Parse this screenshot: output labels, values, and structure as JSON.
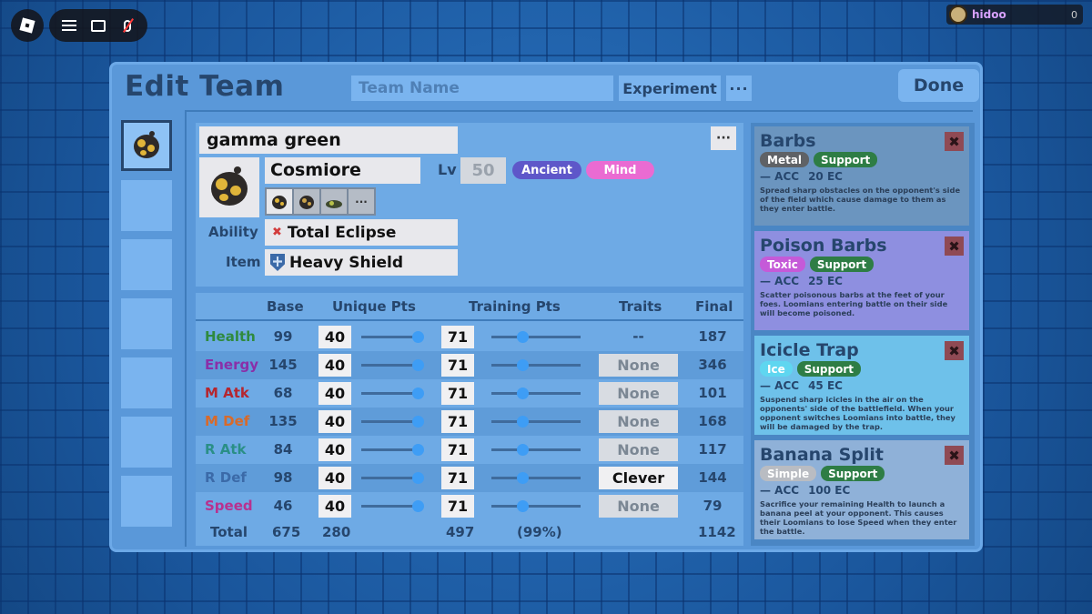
{
  "hud": {
    "username": "hidoo",
    "user_count": "0"
  },
  "header": {
    "title": "Edit Team",
    "team_name_placeholder": "Team Name",
    "experiment_label": "Experiment",
    "more_label": "···",
    "done_label": "Done"
  },
  "loomian": {
    "nickname": "gamma green",
    "species": "Cosmiore",
    "level_label": "Lv",
    "level": "50",
    "types": [
      "Ancient",
      "Mind"
    ],
    "type_colors": [
      "#5e57c9",
      "#ea6bd2"
    ],
    "ability_label": "Ability",
    "ability": "Total Eclipse",
    "item_label": "Item",
    "item": "Heavy Shield",
    "more_label": "···",
    "forms_more": "···"
  },
  "stats": {
    "headers": [
      "Base",
      "Unique Pts",
      "Training Pts",
      "Traits",
      "Final"
    ],
    "rows": [
      {
        "name": "Health",
        "color": "#2f8a3e",
        "base": "99",
        "up": "40",
        "up_fraction": 1.0,
        "tp": "71",
        "tp_fraction": 0.35,
        "trait": "--",
        "final": "187"
      },
      {
        "name": "Energy",
        "color": "#8a2fa8",
        "base": "145",
        "up": "40",
        "up_fraction": 1.0,
        "tp": "71",
        "tp_fraction": 0.35,
        "trait": "None",
        "final": "346"
      },
      {
        "name": "M Atk",
        "color": "#b5262f",
        "base": "68",
        "up": "40",
        "up_fraction": 1.0,
        "tp": "71",
        "tp_fraction": 0.35,
        "trait": "None",
        "final": "101"
      },
      {
        "name": "M Def",
        "color": "#d86a2a",
        "base": "135",
        "up": "40",
        "up_fraction": 1.0,
        "tp": "71",
        "tp_fraction": 0.35,
        "trait": "None",
        "final": "168"
      },
      {
        "name": "R Atk",
        "color": "#2a8f86",
        "base": "84",
        "up": "40",
        "up_fraction": 1.0,
        "tp": "71",
        "tp_fraction": 0.35,
        "trait": "None",
        "final": "117"
      },
      {
        "name": "R Def",
        "color": "#3b6aa8",
        "base": "98",
        "up": "40",
        "up_fraction": 1.0,
        "tp": "71",
        "tp_fraction": 0.35,
        "trait": "Clever",
        "final": "144"
      },
      {
        "name": "Speed",
        "color": "#b8318f",
        "base": "46",
        "up": "40",
        "up_fraction": 1.0,
        "tp": "71",
        "tp_fraction": 0.35,
        "trait": "None",
        "final": "79"
      }
    ],
    "total": {
      "label": "Total",
      "base": "675",
      "up": "280",
      "tp": "497",
      "tp_pct": "(99%)",
      "final": "1142"
    }
  },
  "moves": [
    {
      "name": "Barbs",
      "type": "Metal",
      "type_color": "#5f6266",
      "category": "Support",
      "acc": "— ACC",
      "ec": "20 EC",
      "bg": "#6b95bf",
      "desc": "Spread sharp obstacles on the opponent's side of the field which cause damage to them as they enter battle."
    },
    {
      "name": "Poison Barbs",
      "type": "Toxic",
      "type_color": "#c55ad8",
      "category": "Support",
      "acc": "— ACC",
      "ec": "25 EC",
      "bg": "#8e8fe0",
      "desc": "Scatter poisonous barbs at the feet of your foes. Loomians entering battle on their side will become poisoned."
    },
    {
      "name": "Icicle Trap",
      "type": "Ice",
      "type_color": "#5fd6f0",
      "category": "Support",
      "acc": "— ACC",
      "ec": "45 EC",
      "bg": "#6ec1ea",
      "desc": "Suspend sharp icicles in the air on the opponents' side of the battlefield. When your opponent switches Loomians into battle, they will be damaged by the trap."
    },
    {
      "name": "Banana Split",
      "type": "Simple",
      "type_color": "#b9bcc2",
      "category": "Support",
      "acc": "— ACC",
      "ec": "100 EC",
      "bg": "#8fb1d8",
      "desc": "Sacrifice your remaining Health to launch a banana peel at your opponent. This causes their Loomians to lose Speed when they enter the battle."
    }
  ],
  "move_close_label": "✖"
}
